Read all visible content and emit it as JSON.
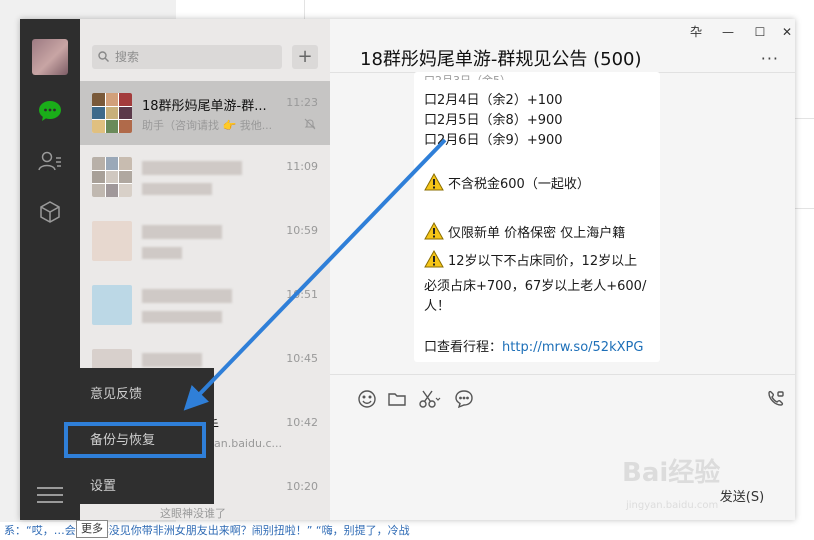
{
  "search": {
    "placeholder": "搜索"
  },
  "list_header": {
    "add_label": "+"
  },
  "chats": [
    {
      "name": "18群彤妈尾单游-群...",
      "snippet": "助手（咨询请找 👉 我他...",
      "time": "11:23"
    },
    {
      "name": "",
      "snippet": "",
      "time": "11:09"
    },
    {
      "name": "",
      "snippet": "",
      "time": "10:59"
    },
    {
      "name": "",
      "snippet": "",
      "time": "10:51"
    },
    {
      "name": "",
      "snippet": "",
      "time": "10:45"
    },
    {
      "name": "手",
      "snippet": "an.baidu.c...",
      "time": "10:42"
    },
    {
      "name": "",
      "snippet": "这眼神没谁了",
      "time": "10:20"
    }
  ],
  "popup_menu": {
    "feedback": "意见反馈",
    "backup": "备份与恢复",
    "settings": "设置"
  },
  "tooltip": "更多",
  "chat": {
    "title": "18群彤妈尾单游-群规见公告 (500)",
    "more_label": "···",
    "lines": [
      "口2月4日（余2）+100",
      "口2月5日（余8）+900",
      "口2月6日（余9）+900",
      "不含税金600（一起收）",
      "仅限新单 价格保密 仅上海户籍",
      "12岁以下不占床同价，12岁以上",
      "必须占床+700，67岁以上老人+600/",
      "人！"
    ],
    "itinerary_prefix": "口查看行程：",
    "itinerary_link": "http://mrw.so/52kXPG",
    "send_label": "发送(S)"
  },
  "window_controls": {
    "pin": "卆",
    "minimize": "—",
    "maximize": "☐",
    "close": "✕"
  },
  "footer_text": "系：“哎，…会怎么都没见你带非洲女朋友出来啊？闹别扭啦！” “嗨，别提了，冷战",
  "watermark": {
    "brand": "Bai经验",
    "url": "jingyan.baidu.com"
  },
  "colors": {
    "highlight": "#2f7fd8",
    "nav_bg": "#2e2e2e",
    "chat_icon": "#1aad19",
    "link": "#1d6fb8"
  },
  "icons": [
    "search-icon",
    "chat-icon",
    "contacts-icon",
    "favorites-icon",
    "menu-icon",
    "mute-icon",
    "emoji-icon",
    "folder-icon",
    "scissors-icon",
    "comment-icon",
    "video-call-icon",
    "warning-icon"
  ]
}
